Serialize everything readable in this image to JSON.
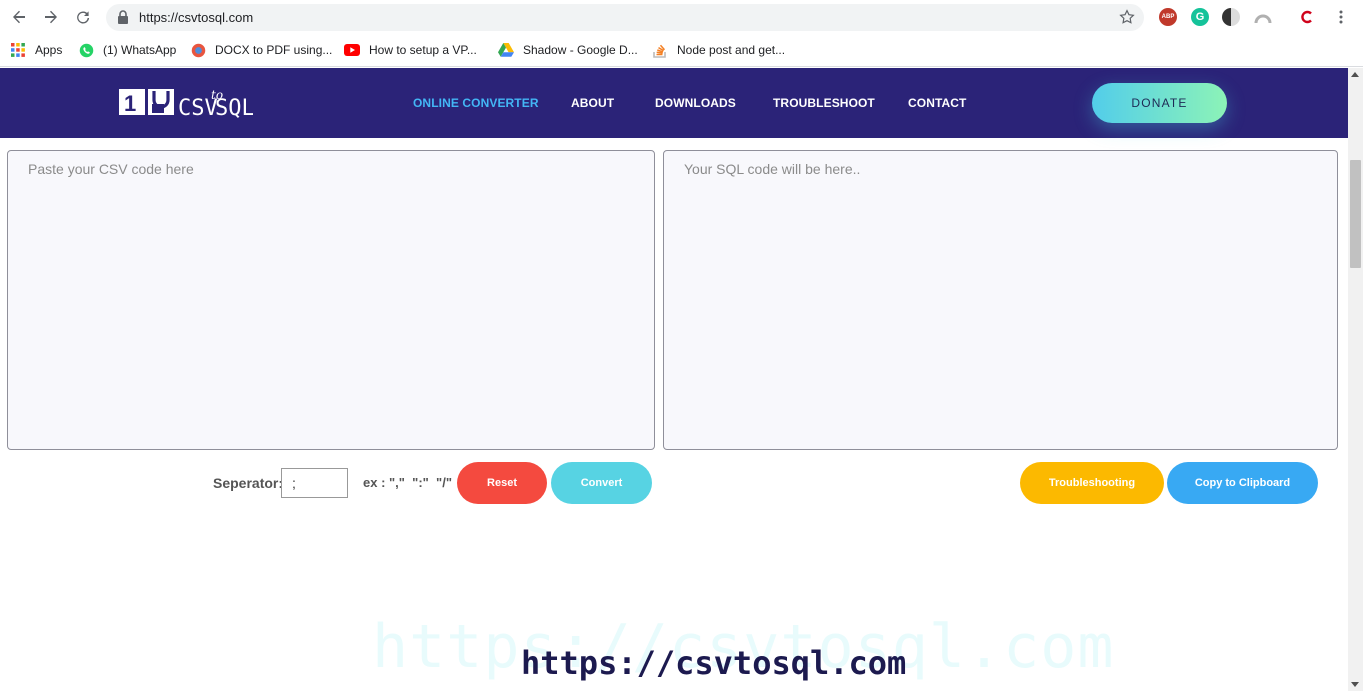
{
  "browser": {
    "url": "https://csvtosql.com",
    "bookmarks": [
      {
        "label": "Apps",
        "icon": "apps-grid-icon"
      },
      {
        "label": "(1) WhatsApp",
        "icon": "whatsapp-icon"
      },
      {
        "label": "DOCX to PDF using...",
        "icon": "docx-pdf-icon"
      },
      {
        "label": "How to setup a VP...",
        "icon": "youtube-icon"
      },
      {
        "label": "Shadow - Google D...",
        "icon": "google-drive-icon"
      },
      {
        "label": "Node post and get...",
        "icon": "stackoverflow-icon"
      }
    ],
    "extensions": [
      {
        "label": "ABP",
        "color": "#c0392b"
      },
      {
        "label": "G",
        "color": "#15c39a"
      }
    ]
  },
  "header": {
    "logo": {
      "digits": "1",
      "brand_left": "CSV",
      "brand_to": "to",
      "brand_right": "SQL"
    },
    "nav": [
      "ONLINE CONVERTER",
      "ABOUT",
      "DOWNLOADS",
      "TROUBLESHOOT",
      "CONTACT"
    ],
    "donate_label": "DONATE"
  },
  "editor": {
    "csv_placeholder": "Paste your CSV code here",
    "sql_placeholder": "Your SQL code will be here.."
  },
  "controls": {
    "separator_label": "Seperator:",
    "separator_value": ";",
    "separator_example": "ex : \",\"  \":\"  \"/\"",
    "reset_label": "Reset",
    "convert_label": "Convert",
    "troubleshooting_label": "Troubleshooting",
    "copy_label": "Copy to Clipboard"
  },
  "watermark": {
    "background_text": "https://csvtosql.com",
    "text": "https://csvtosql.com"
  },
  "colors": {
    "header_bg": "#2b2378",
    "nav_active": "#43b6f5",
    "reset": "#f44a3f",
    "convert": "#57d3e3",
    "troubleshooting": "#fcb900",
    "copy": "#38a9f3"
  }
}
